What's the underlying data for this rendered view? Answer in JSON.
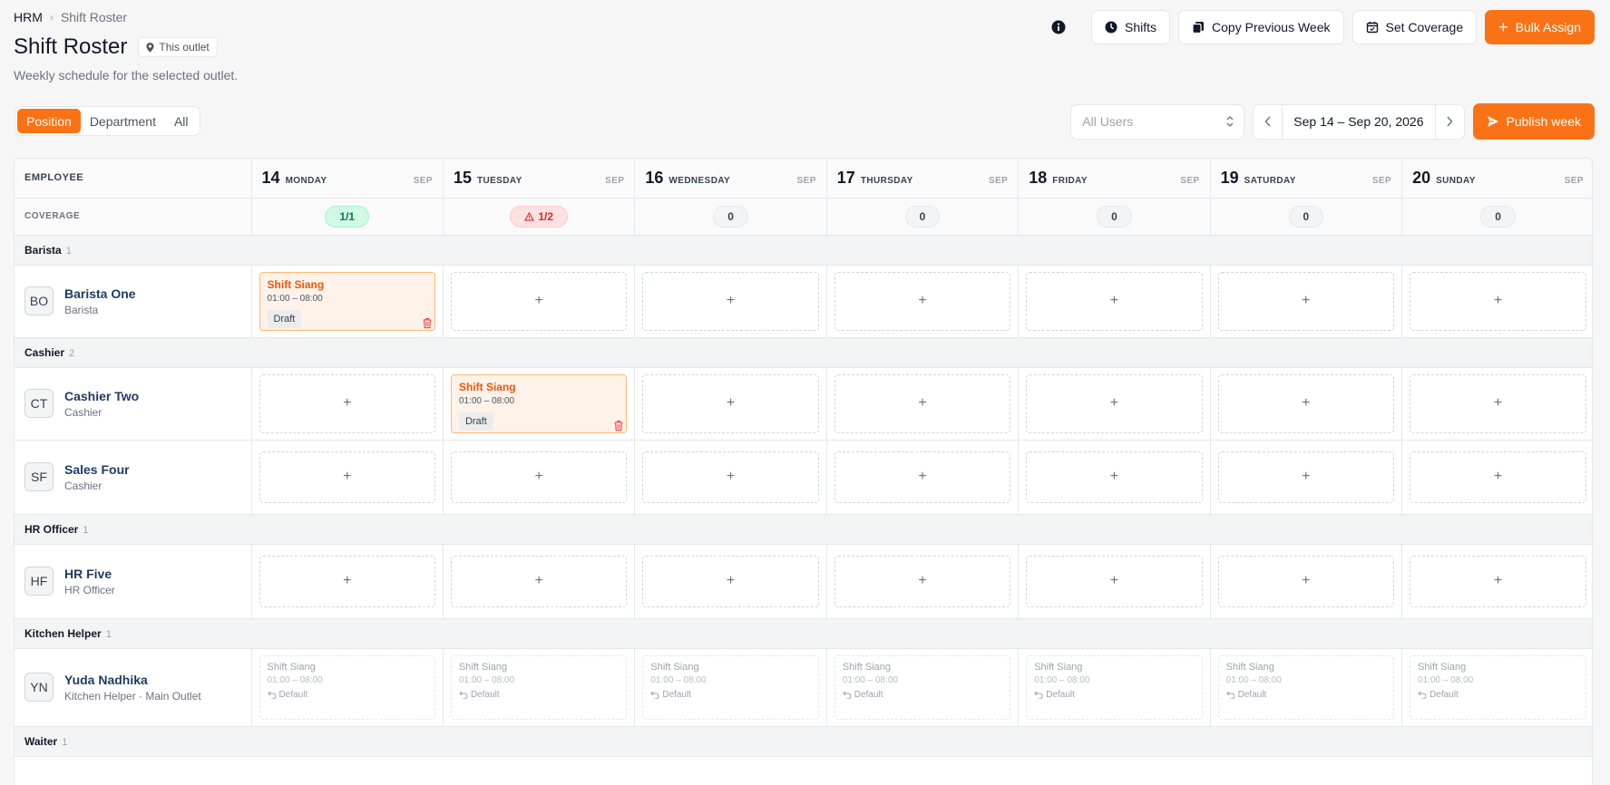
{
  "breadcrumb": {
    "root": "HRM",
    "current": "Shift Roster"
  },
  "page": {
    "title": "Shift Roster",
    "outlet_chip": "This outlet",
    "subtitle": "Weekly schedule for the selected outlet."
  },
  "actions": {
    "shifts": "Shifts",
    "copy_previous_week": "Copy Previous Week",
    "set_coverage": "Set Coverage",
    "bulk_assign": "Bulk Assign"
  },
  "view_toggle": {
    "options": [
      "Position",
      "Department",
      "All"
    ],
    "selected": "Position"
  },
  "filters": {
    "user_select_placeholder": "All Users",
    "week_range": "Sep 14 – Sep 20, 2026",
    "publish_label": "Publish week"
  },
  "colors": {
    "accent": "#f97316",
    "coverage_ok": "#047857",
    "coverage_warn": "#dc2626"
  },
  "grid": {
    "employee_header": "EMPLOYEE",
    "coverage_label": "COVERAGE",
    "days": [
      {
        "num": "14",
        "name": "MONDAY",
        "month": "SEP",
        "coverage": "1/1",
        "status": "ok"
      },
      {
        "num": "15",
        "name": "TUESDAY",
        "month": "SEP",
        "coverage": "1/2",
        "status": "warn"
      },
      {
        "num": "16",
        "name": "WEDNESDAY",
        "month": "SEP",
        "coverage": "0",
        "status": "none"
      },
      {
        "num": "17",
        "name": "THURSDAY",
        "month": "SEP",
        "coverage": "0",
        "status": "none"
      },
      {
        "num": "18",
        "name": "FRIDAY",
        "month": "SEP",
        "coverage": "0",
        "status": "none"
      },
      {
        "num": "19",
        "name": "SATURDAY",
        "month": "SEP",
        "coverage": "0",
        "status": "none"
      },
      {
        "num": "20",
        "name": "SUNDAY",
        "month": "SEP",
        "coverage": "0",
        "status": "none"
      }
    ],
    "add_symbol": "+",
    "groups": [
      {
        "name": "Barista",
        "count": "1",
        "employees": [
          {
            "initials": "BO",
            "name": "Barista One",
            "role": "Barista",
            "cells": [
              {
                "type": "draft",
                "shift": "Shift Siang",
                "time": "01:00 – 08:00",
                "badge": "Draft"
              },
              {
                "type": "empty"
              },
              {
                "type": "empty"
              },
              {
                "type": "empty"
              },
              {
                "type": "empty"
              },
              {
                "type": "empty"
              },
              {
                "type": "empty"
              }
            ]
          }
        ]
      },
      {
        "name": "Cashier",
        "count": "2",
        "employees": [
          {
            "initials": "CT",
            "name": "Cashier Two",
            "role": "Cashier",
            "cells": [
              {
                "type": "empty"
              },
              {
                "type": "draft",
                "shift": "Shift Siang",
                "time": "01:00 – 08:00",
                "badge": "Draft"
              },
              {
                "type": "empty"
              },
              {
                "type": "empty"
              },
              {
                "type": "empty"
              },
              {
                "type": "empty"
              },
              {
                "type": "empty"
              }
            ]
          },
          {
            "initials": "SF",
            "name": "Sales Four",
            "role": "Cashier",
            "cells": [
              {
                "type": "empty"
              },
              {
                "type": "empty"
              },
              {
                "type": "empty"
              },
              {
                "type": "empty"
              },
              {
                "type": "empty"
              },
              {
                "type": "empty"
              },
              {
                "type": "empty"
              }
            ]
          }
        ]
      },
      {
        "name": "HR Officer",
        "count": "1",
        "employees": [
          {
            "initials": "HF",
            "name": "HR Five",
            "role": "HR Officer",
            "cells": [
              {
                "type": "empty"
              },
              {
                "type": "empty"
              },
              {
                "type": "empty"
              },
              {
                "type": "empty"
              },
              {
                "type": "empty"
              },
              {
                "type": "empty"
              },
              {
                "type": "empty"
              }
            ]
          }
        ]
      },
      {
        "name": "Kitchen Helper",
        "count": "1",
        "employees": [
          {
            "initials": "YN",
            "name": "Yuda Nadhika",
            "role": "Kitchen Helper · Main Outlet",
            "cells": [
              {
                "type": "default",
                "shift": "Shift Siang",
                "time": "01:00 – 08:00",
                "tag": "Default"
              },
              {
                "type": "default",
                "shift": "Shift Siang",
                "time": "01:00 – 08:00",
                "tag": "Default"
              },
              {
                "type": "default",
                "shift": "Shift Siang",
                "time": "01:00 – 08:00",
                "tag": "Default"
              },
              {
                "type": "default",
                "shift": "Shift Siang",
                "time": "01:00 – 08:00",
                "tag": "Default"
              },
              {
                "type": "default",
                "shift": "Shift Siang",
                "time": "01:00 – 08:00",
                "tag": "Default"
              },
              {
                "type": "default",
                "shift": "Shift Siang",
                "time": "01:00 – 08:00",
                "tag": "Default"
              },
              {
                "type": "default",
                "shift": "Shift Siang",
                "time": "01:00 – 08:00",
                "tag": "Default"
              }
            ]
          }
        ]
      },
      {
        "name": "Waiter",
        "count": "1",
        "employees": []
      }
    ]
  }
}
